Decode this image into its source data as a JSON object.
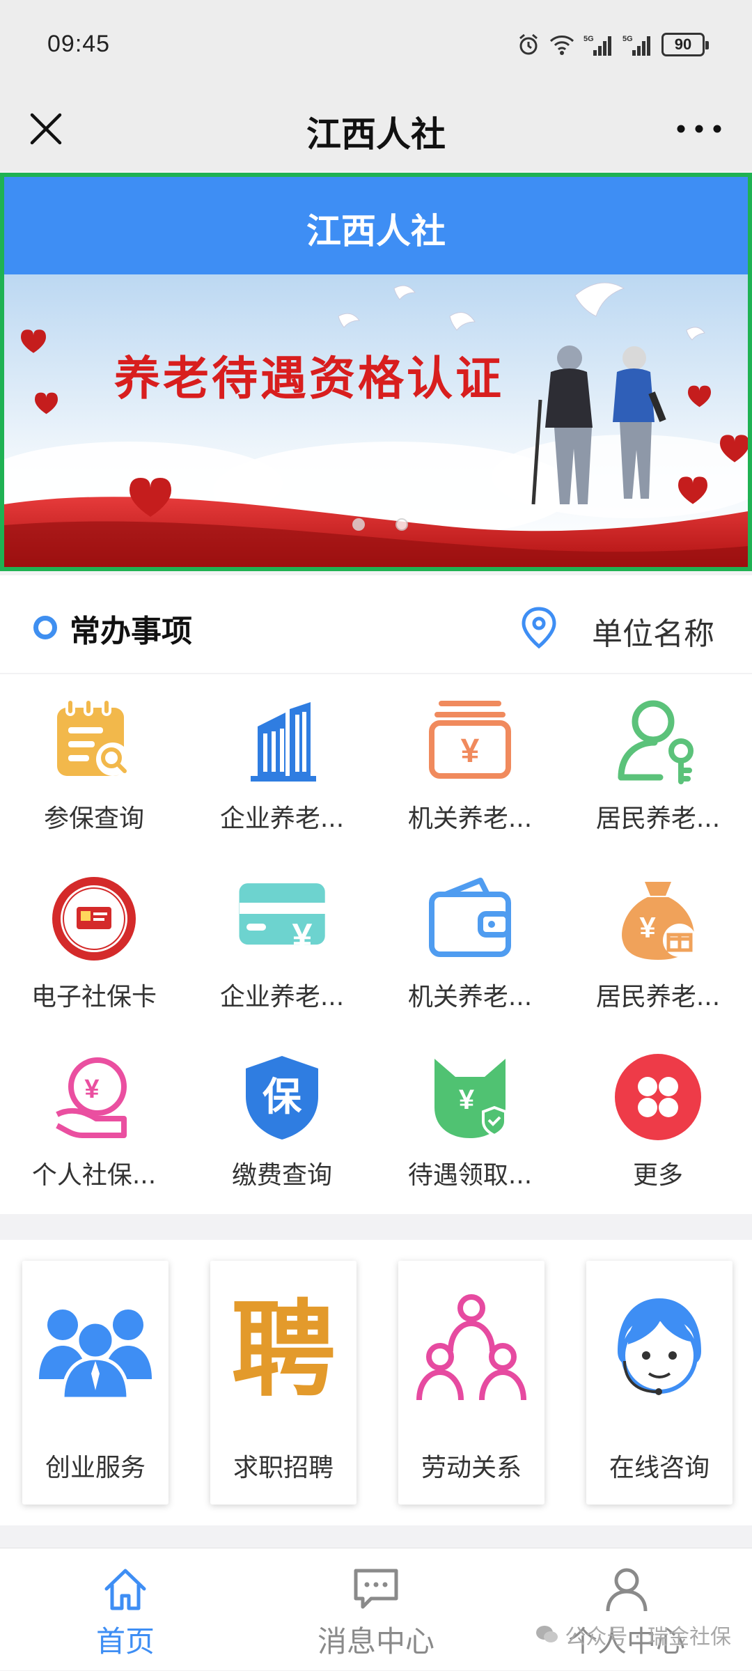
{
  "status_bar": {
    "time": "09:45",
    "battery": "90",
    "signal1": "5G",
    "signal2": "5G"
  },
  "nav": {
    "title": "江西人社"
  },
  "banner": {
    "header_title": "江西人社",
    "slogan": "养老待遇资格认证",
    "slide_count": 2,
    "active_slide": 2
  },
  "section": {
    "title": "常办事项",
    "location_label": "单位名称"
  },
  "grid": [
    {
      "label": "参保查询",
      "icon": "document-search-icon"
    },
    {
      "label": "企业养老...",
      "icon": "building-icon"
    },
    {
      "label": "机关养老...",
      "icon": "yuan-box-icon"
    },
    {
      "label": "居民养老...",
      "icon": "person-key-icon"
    },
    {
      "label": "电子社保卡",
      "icon": "social-security-card-icon"
    },
    {
      "label": "企业养老...",
      "icon": "yuan-card-icon"
    },
    {
      "label": "机关养老...",
      "icon": "wallet-icon"
    },
    {
      "label": "居民养老...",
      "icon": "money-bag-icon"
    },
    {
      "label": "个人社保...",
      "icon": "hand-coin-icon"
    },
    {
      "label": "缴费查询",
      "icon": "shield-bao-icon"
    },
    {
      "label": "待遇领取...",
      "icon": "cat-shield-icon"
    },
    {
      "label": "更多",
      "icon": "more-grid-icon"
    }
  ],
  "cards": [
    {
      "label": "创业服务",
      "icon": "team-icon"
    },
    {
      "label": "求职招聘",
      "icon": "recruit-icon"
    },
    {
      "label": "劳动关系",
      "icon": "people-network-icon"
    },
    {
      "label": "在线咨询",
      "icon": "customer-service-icon"
    }
  ],
  "tabs": [
    {
      "label": "首页",
      "icon": "home-icon",
      "active": true
    },
    {
      "label": "消息中心",
      "icon": "message-icon",
      "active": false
    },
    {
      "label": "个人中心",
      "icon": "person-icon",
      "active": false
    }
  ],
  "watermark": "公众号 · 瑞金社保",
  "colors": {
    "primary": "#3e8ef4",
    "banner_border": "#1fb253",
    "banner_slogan": "#d81e1e"
  }
}
